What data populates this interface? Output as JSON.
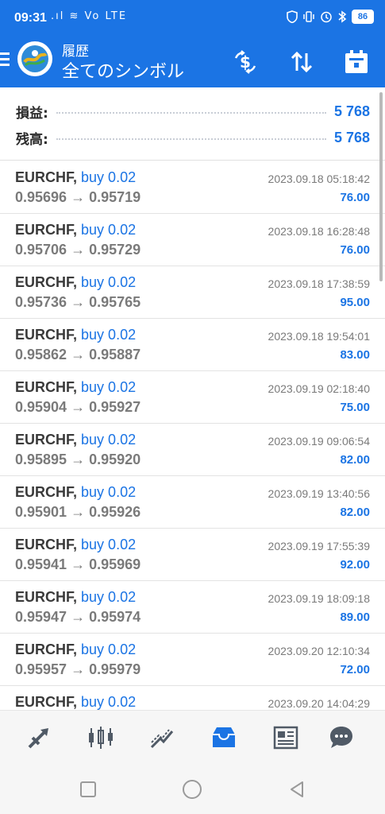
{
  "status_bar": {
    "time": "09:31",
    "left_icons": ".ıl ≋ Vo LTE",
    "battery": "86"
  },
  "header": {
    "subtitle": "履歴",
    "title": "全てのシンボル",
    "icons": [
      "menu-icon",
      "app-logo",
      "currency-exchange-icon",
      "sort-icon",
      "calendar-icon"
    ]
  },
  "summary": {
    "profit_label": "損益:",
    "profit_value": "5 768",
    "balance_label": "残高:",
    "balance_value": "5 768"
  },
  "trades": [
    {
      "symbol": "EURCHF,",
      "side": "buy 0.02",
      "prices": "0.95696 → 0.95719",
      "time": "2023.09.18 05:18:42",
      "profit": "76.00"
    },
    {
      "symbol": "EURCHF,",
      "side": "buy 0.02",
      "prices": "0.95706 → 0.95729",
      "time": "2023.09.18 16:28:48",
      "profit": "76.00"
    },
    {
      "symbol": "EURCHF,",
      "side": "buy 0.02",
      "prices": "0.95736 → 0.95765",
      "time": "2023.09.18 17:38:59",
      "profit": "95.00"
    },
    {
      "symbol": "EURCHF,",
      "side": "buy 0.02",
      "prices": "0.95862 → 0.95887",
      "time": "2023.09.18 19:54:01",
      "profit": "83.00"
    },
    {
      "symbol": "EURCHF,",
      "side": "buy 0.02",
      "prices": "0.95904 → 0.95927",
      "time": "2023.09.19 02:18:40",
      "profit": "75.00"
    },
    {
      "symbol": "EURCHF,",
      "side": "buy 0.02",
      "prices": "0.95895 → 0.95920",
      "time": "2023.09.19 09:06:54",
      "profit": "82.00"
    },
    {
      "symbol": "EURCHF,",
      "side": "buy 0.02",
      "prices": "0.95901 → 0.95926",
      "time": "2023.09.19 13:40:56",
      "profit": "82.00"
    },
    {
      "symbol": "EURCHF,",
      "side": "buy 0.02",
      "prices": "0.95941 → 0.95969",
      "time": "2023.09.19 17:55:39",
      "profit": "92.00"
    },
    {
      "symbol": "EURCHF,",
      "side": "buy 0.02",
      "prices": "0.95947 → 0.95974",
      "time": "2023.09.19 18:09:18",
      "profit": "89.00"
    },
    {
      "symbol": "EURCHF,",
      "side": "buy 0.02",
      "prices": "0.95957 → 0.95979",
      "time": "2023.09.20 12:10:34",
      "profit": "72.00"
    },
    {
      "symbol": "EURCHF,",
      "side": "buy 0.02",
      "prices": "",
      "time": "2023.09.20 14:04:29",
      "profit": ""
    }
  ],
  "bottom_nav": {
    "items": [
      "quotes-icon",
      "chart-icon",
      "trade-icon",
      "history-icon",
      "news-icon",
      "chat-icon"
    ],
    "active": "history-icon"
  },
  "colors": {
    "accent": "#1b74e4",
    "text_dark": "#3a3a3a",
    "text_gray": "#7a7a7a",
    "nav_inactive": "#505a66"
  }
}
